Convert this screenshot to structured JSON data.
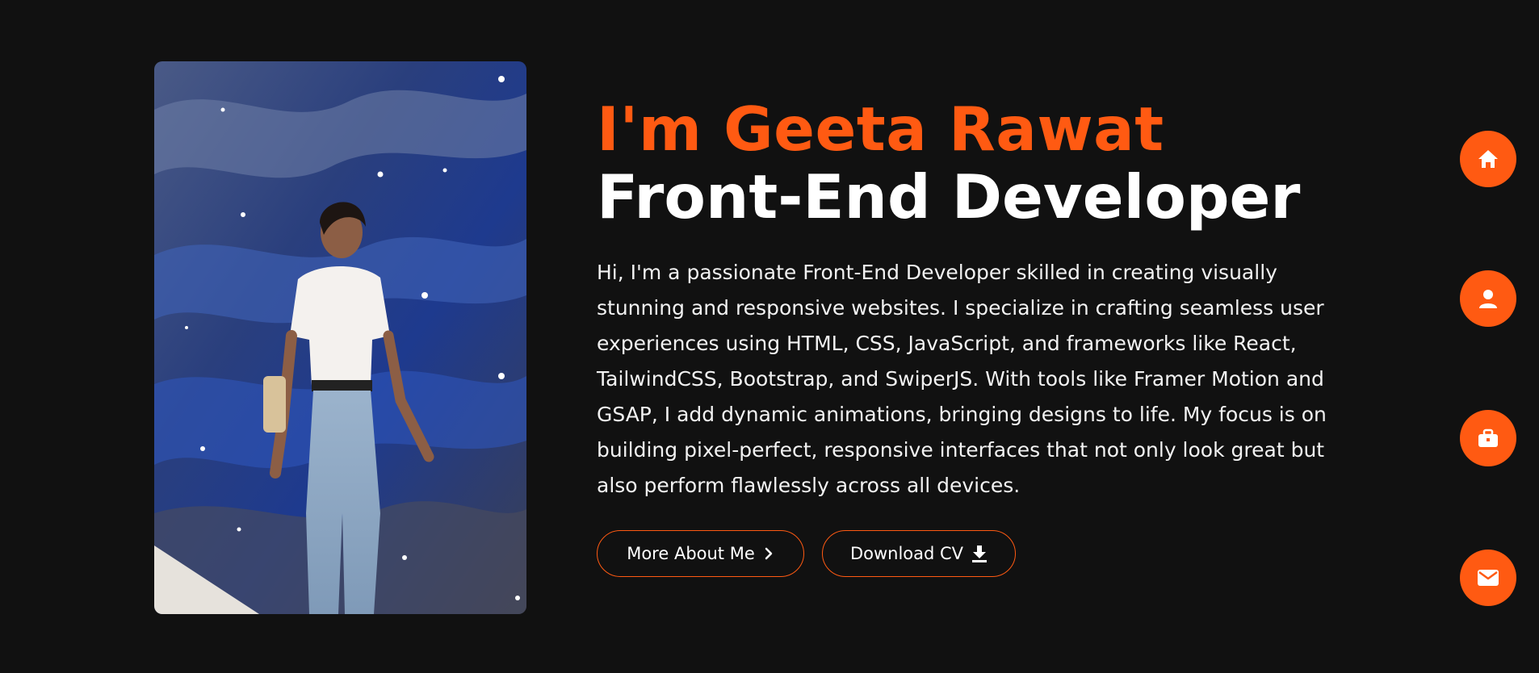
{
  "hero": {
    "greeting": "I'm Geeta Rawat",
    "role": "Front-End Developer",
    "bio": "Hi, I'm a passionate Front-End Developer skilled in creating visually stunning and responsive websites. I specialize in crafting seamless user experiences using HTML, CSS, JavaScript, and frameworks like React, TailwindCSS, Bootstrap, and SwiperJS. With tools like Framer Motion and GSAP, I add dynamic animations, bringing designs to life. My focus is on building pixel-perfect, responsive interfaces that not only look great but also perform flawlessly across all devices."
  },
  "buttons": {
    "more_label": "More About Me",
    "more_icon": "chevron-right-icon",
    "cv_label": "Download CV",
    "cv_icon": "download-icon"
  },
  "side_nav": [
    {
      "icon": "home-icon"
    },
    {
      "icon": "user-icon"
    },
    {
      "icon": "briefcase-icon"
    },
    {
      "icon": "mail-icon"
    }
  ],
  "colors": {
    "background": "#111111",
    "accent": "#ff5a12",
    "text": "#ffffff"
  }
}
